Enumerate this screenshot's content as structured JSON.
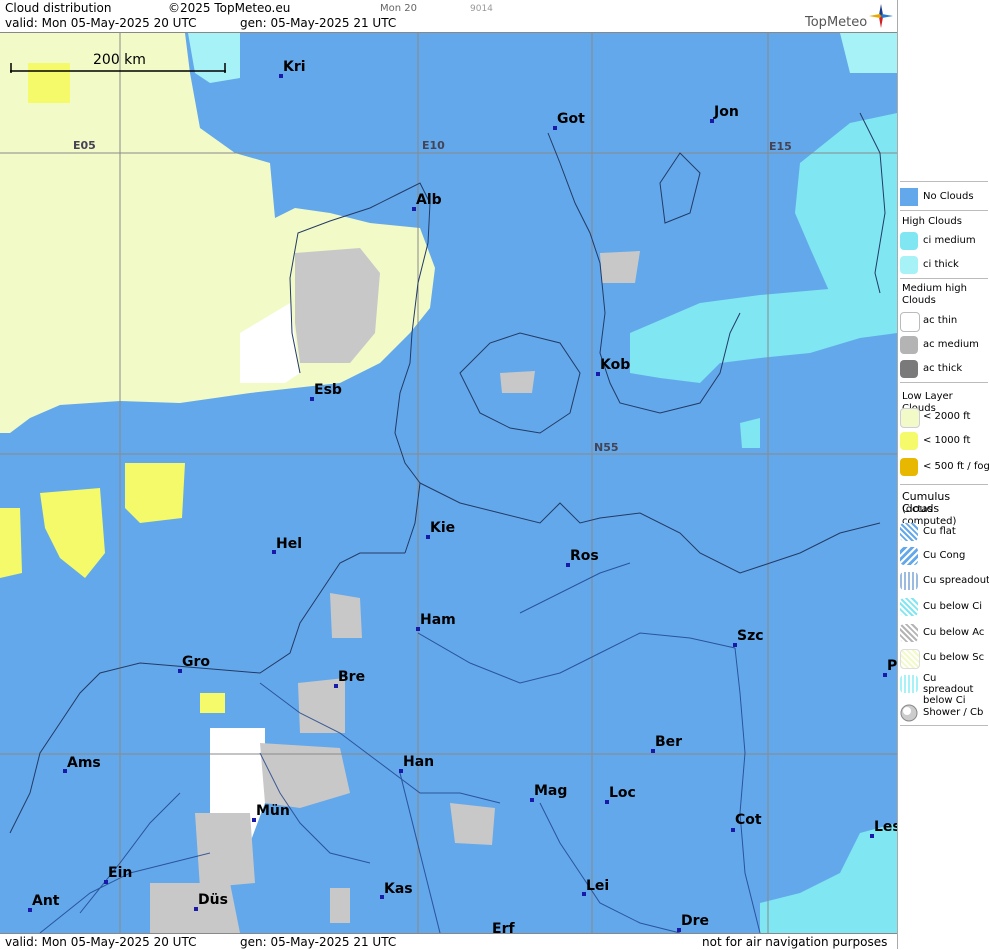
{
  "header": {
    "product": "Cloud distribution",
    "copyright": "©2025 TopMeteo.eu",
    "valid": "valid:  Mon  05-May-2025  20 UTC",
    "gen": "gen: 05-May-2025 21 UTC",
    "run": "Mon 20",
    "code": "9014",
    "brand": "TopMeteo"
  },
  "footer": {
    "valid": "valid:  Mon  05-May-2025  20 UTC",
    "gen": "gen: 05-May-2025 21 UTC",
    "disclaimer": "not for air navigation purposes"
  },
  "map": {
    "scale_label": "200 km",
    "grid_labels": {
      "e05": "E05",
      "e10": "E10",
      "e15": "E15",
      "n55": "N55"
    },
    "cities": {
      "kri": "Kri",
      "got": "Got",
      "jon": "Jon",
      "alb": "Alb",
      "kob": "Kob",
      "esb": "Esb",
      "kie": "Kie",
      "hel": "Hel",
      "ros": "Ros",
      "ham": "Ham",
      "szc": "Szc",
      "gro": "Gro",
      "bre": "Bre",
      "p": "P",
      "ber": "Ber",
      "ams": "Ams",
      "han": "Han",
      "mag": "Mag",
      "loc": "Loc",
      "mun": "Mün",
      "cot": "Cot",
      "les": "Les",
      "ein": "Ein",
      "kas": "Kas",
      "lei": "Lei",
      "ant": "Ant",
      "dus": "Düs",
      "dre": "Dre",
      "erf": "Erf"
    }
  },
  "legend": {
    "no_clouds": "No Clouds",
    "high_clouds": "High Clouds",
    "ci_medium": "ci medium",
    "ci_thick": "ci thick",
    "medium_high": "Medium high Clouds",
    "ac_thin": "ac thin",
    "ac_medium": "ac medium",
    "ac_thick": "ac thick",
    "low_layer": "Low Layer Clouds",
    "lt2000": "< 2000 ft",
    "lt1000": "< 1000 ft",
    "lt500": "< 500 ft / fog",
    "cumulus": "Cumulus Clouds",
    "octas": "(octas computed)",
    "cu_flat": "Cu flat",
    "cu_cong": "Cu Cong",
    "cu_spreadout": "Cu spreadout",
    "cu_below_ci": "Cu below Ci",
    "cu_below_ac": "Cu below Ac",
    "cu_below_sc": "Cu below Sc",
    "cu_spread_below_ci": "Cu spreadout below Ci",
    "shower_cb": "Shower / Cb"
  },
  "colors": {
    "no_clouds": "#63a8ea",
    "ci_medium": "#7fe6f2",
    "ci_thick": "#a6f2f6",
    "ac_thin": "#ffffff",
    "ac_medium": "#b4b4b4",
    "ac_thick": "#7a7a7a",
    "low_2000": "#f2fac8",
    "low_1000": "#f4fa6a",
    "low_500": "#e8b800"
  }
}
